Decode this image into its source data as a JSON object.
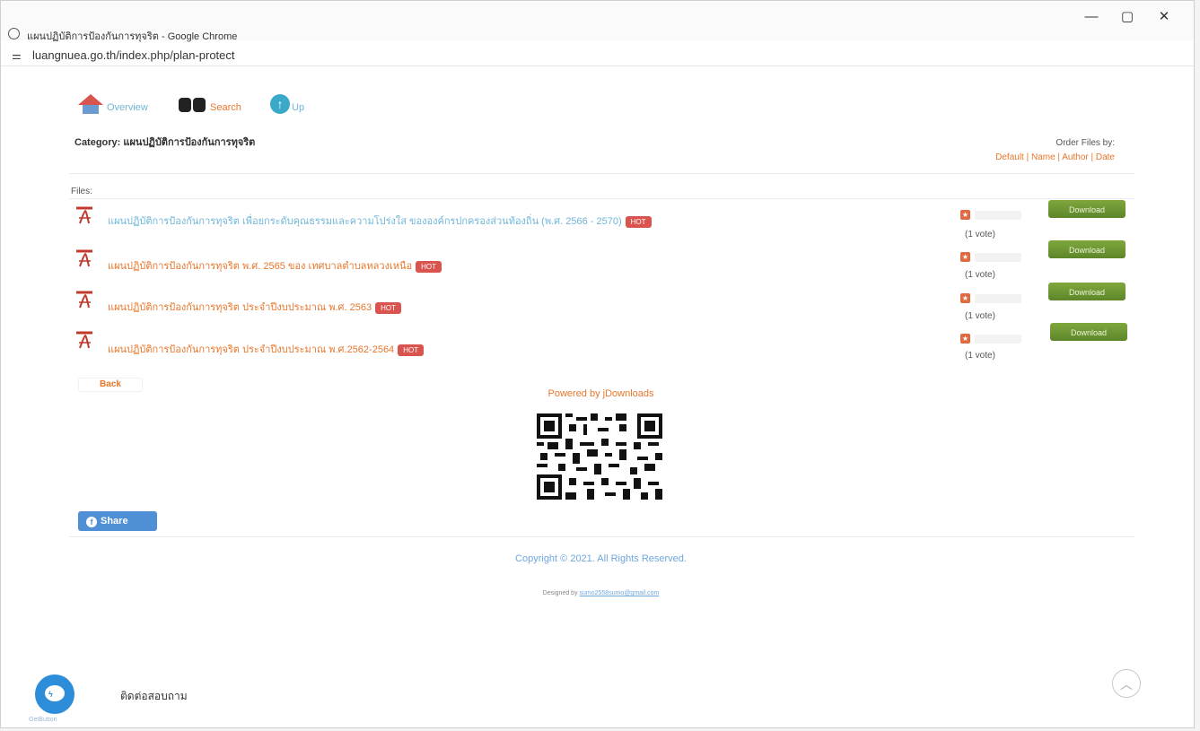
{
  "browser": {
    "window_title": "แผนปฏิบัติการป้องกันการทุจริต - Google Chrome",
    "url": "luangnuea.go.th/index.php/plan-protect",
    "minimize_glyph": "—",
    "maximize_glyph": "▢",
    "close_glyph": "✕"
  },
  "nav": {
    "overview_label": "Overview",
    "search_label": "Search",
    "up_label": "Up"
  },
  "category": {
    "label": "Category: แผนปฏิบัติการป้องกันการทุจริต"
  },
  "order": {
    "label": "Order Files by:",
    "links": "Default | Name | Author | Date"
  },
  "files_label": "Files:",
  "files": [
    {
      "title": "แผนปฏิบัติการป้องกันการทุจริต เพื่อยกระดับคุณธรรมและความโปร่งใส ขององค์กรปกครองส่วนท้องถิ่น (พ.ศ. 2566 - 2570)",
      "title_color": "#6fb6d9",
      "badge": "HOT",
      "votes": "(1 vote)",
      "download_label": "Download"
    },
    {
      "title": "แผนปฏิบัติการป้องกันการทุจริต พ.ศ. 2565 ของ เทศบาลตำบลหลวงเหนือ",
      "title_color": "#e8762b",
      "badge": "HOT",
      "votes": "(1 vote)",
      "download_label": "Download"
    },
    {
      "title": "แผนปฏิบัติการป้องกันการทุจริต ประจำปีงบประมาณ พ.ศ. 2563",
      "title_color": "#e8762b",
      "badge": "HOT",
      "votes": "(1 vote)",
      "download_label": "Download"
    },
    {
      "title": "แผนปฏิบัติการป้องกันการทุจริต ประจำปีงบประมาณ พ.ศ.2562-2564",
      "title_color": "#e8762b",
      "badge": "HOT",
      "votes": "(1 vote)",
      "download_label": "Download"
    }
  ],
  "back_label": "Back",
  "powered_by": "Powered by jDownloads",
  "share_label": "Share",
  "footer": {
    "copyright": "Copyright © 2021. All Rights Reserved.",
    "designed_prefix": "Designed by ",
    "designed_email": "sumo2558sumo@gmail.com"
  },
  "widgets": {
    "getbutton_label": "GetButton",
    "contact_label": "ติดต่อสอบถาม",
    "scroll_top_glyph": "︿"
  },
  "colors": {
    "accent": "#e8762b",
    "download_green": "#6b9632",
    "hot_red": "#d9534f",
    "facebook_blue": "#4f8fd6",
    "messenger_blue": "#2e8dd8"
  }
}
